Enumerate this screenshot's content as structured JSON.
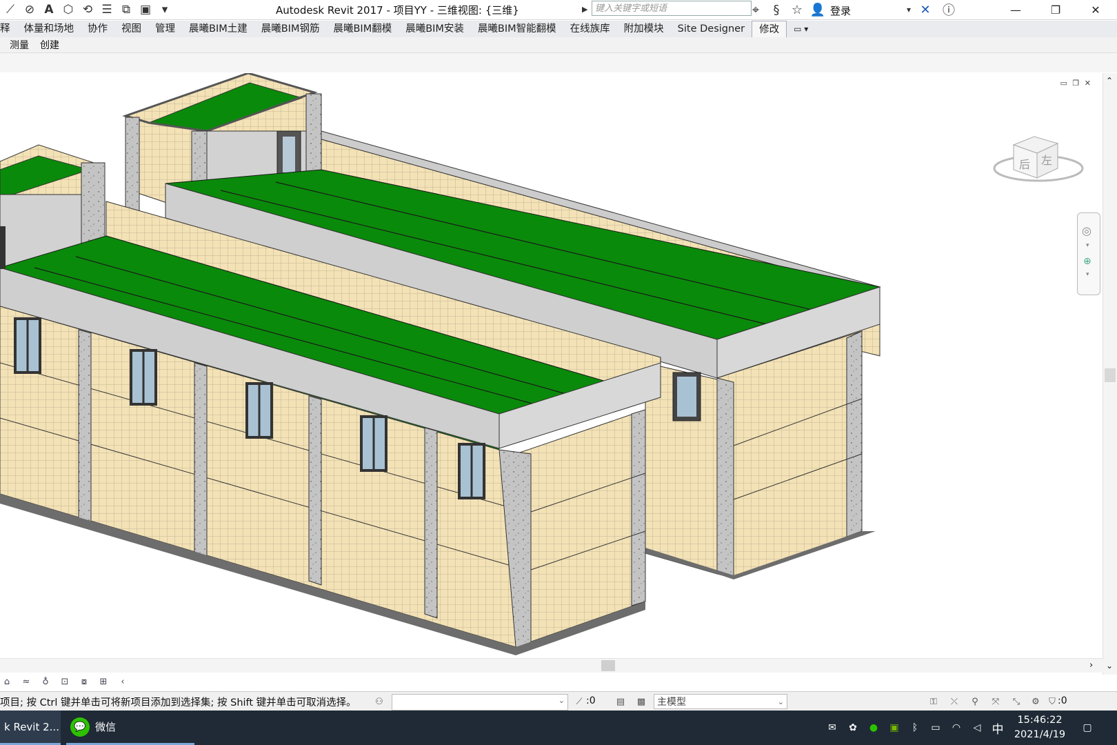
{
  "titlebar": {
    "title": "Autodesk Revit 2017 -     项目YY - 三维视图: {三维}",
    "search_placeholder": "键入关键字或短语",
    "login": "登录",
    "qat_icons": [
      "measure-icon",
      "tag-icon",
      "text-icon",
      "3d-view-icon",
      "sync-icon",
      "thin-lines-icon",
      "close-hidden-icon",
      "switch-windows-icon",
      "customize-icon"
    ],
    "right_icons": [
      "binoculars-icon",
      "subscription-icon",
      "favorites-icon",
      "user-icon",
      "exchange-icon",
      "help-icon"
    ],
    "window_controls": [
      "minimize",
      "restore",
      "close"
    ]
  },
  "ribbon": {
    "tabs": [
      "释",
      "体量和场地",
      "协作",
      "视图",
      "管理",
      "晨曦BIM土建",
      "晨曦BIM钢筋",
      "晨曦BIM翻模",
      "晨曦BIM安装",
      "晨曦BIM智能翻模",
      "在线族库",
      "附加模块",
      "Site Designer",
      "修改"
    ],
    "active_tab": "修改",
    "panels": [
      "测量",
      "创建"
    ]
  },
  "viewport": {
    "view_name": "三维",
    "viewcube": {
      "face_left": "后",
      "face_right": "左"
    },
    "colors": {
      "roof": "#0a8a0a",
      "wall": "#f3e2b6",
      "parapet": "#cfcfcf",
      "column": "#bcbcbc"
    }
  },
  "viewcontrol": {
    "icons": [
      "visual-style-icon",
      "sun-path-icon",
      "shadows-icon",
      "crop-icon",
      "temp-hide-icon",
      "reveal-icon",
      "scroll-left-icon"
    ]
  },
  "statusbar": {
    "message": "项目; 按 Ctrl 键并单击可将新项目添加到选择集; 按 Shift 键并单击可取消选择。",
    "selection_count": ":0",
    "model": "主模型",
    "filter_count": ":0"
  },
  "taskbar": {
    "apps": [
      {
        "label": "k Revit 2...",
        "icon": "revit-icon"
      },
      {
        "label": "微信",
        "icon": "wechat-icon"
      }
    ],
    "tray": [
      "mail-icon",
      "photos-icon",
      "wechat-tray-icon",
      "nvidia-icon",
      "bluetooth-icon",
      "battery-icon",
      "wifi-icon",
      "volume-icon"
    ],
    "ime": "中",
    "time": "15:46:22",
    "date": "2021/4/19"
  }
}
